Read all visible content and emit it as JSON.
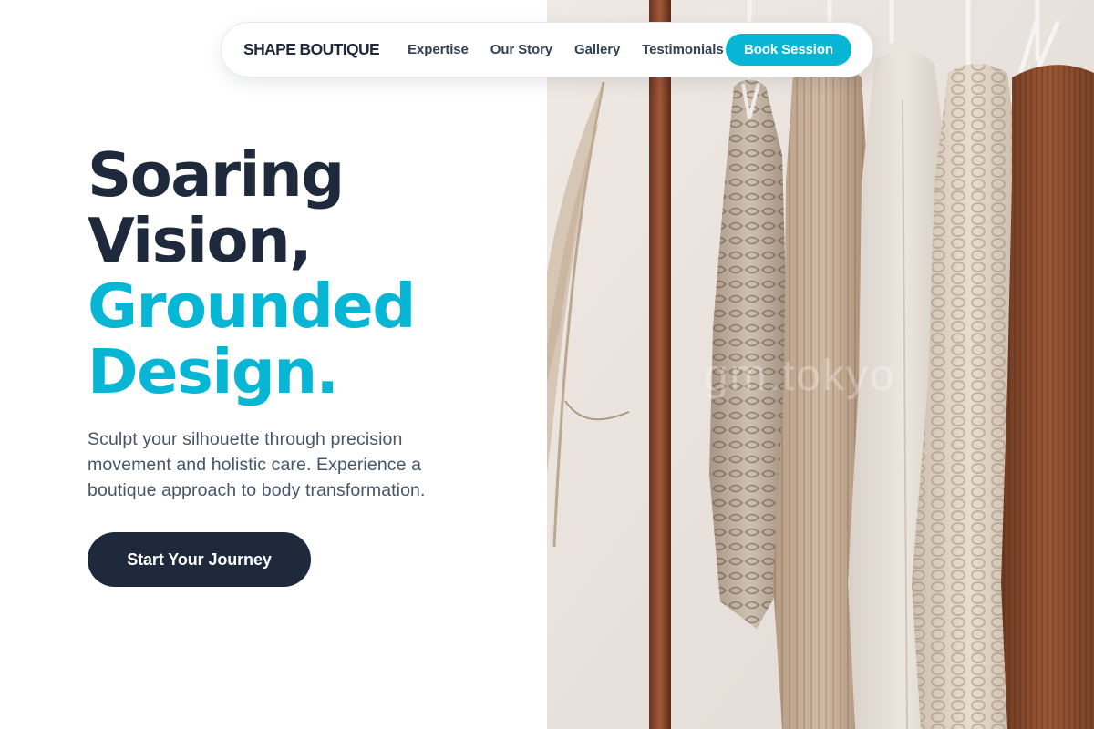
{
  "brand": {
    "name": "SHAPE BOUTIQUE"
  },
  "nav": {
    "links": [
      {
        "label": "Expertise"
      },
      {
        "label": "Our Story"
      },
      {
        "label": "Gallery"
      },
      {
        "label": "Testimonials"
      }
    ],
    "cta_label": "Book Session"
  },
  "hero": {
    "headline_lines": [
      {
        "text": "Soaring",
        "style": "dark"
      },
      {
        "text": "Vision,",
        "style": "dark"
      },
      {
        "text": "Grounded",
        "style": "accent"
      },
      {
        "text": "Design.",
        "style": "accent"
      }
    ],
    "subtext": "Sculpt your silhouette through precision movement and holistic care. Experience a boutique approach to body transformation.",
    "cta_label": "Start Your Journey",
    "image_watermark": "gm.tokyo"
  },
  "colors": {
    "accent": "#06b6d4",
    "dark": "#1e293b",
    "body_text": "#475569",
    "nav_text": "#334155",
    "background": "#ffffff"
  }
}
